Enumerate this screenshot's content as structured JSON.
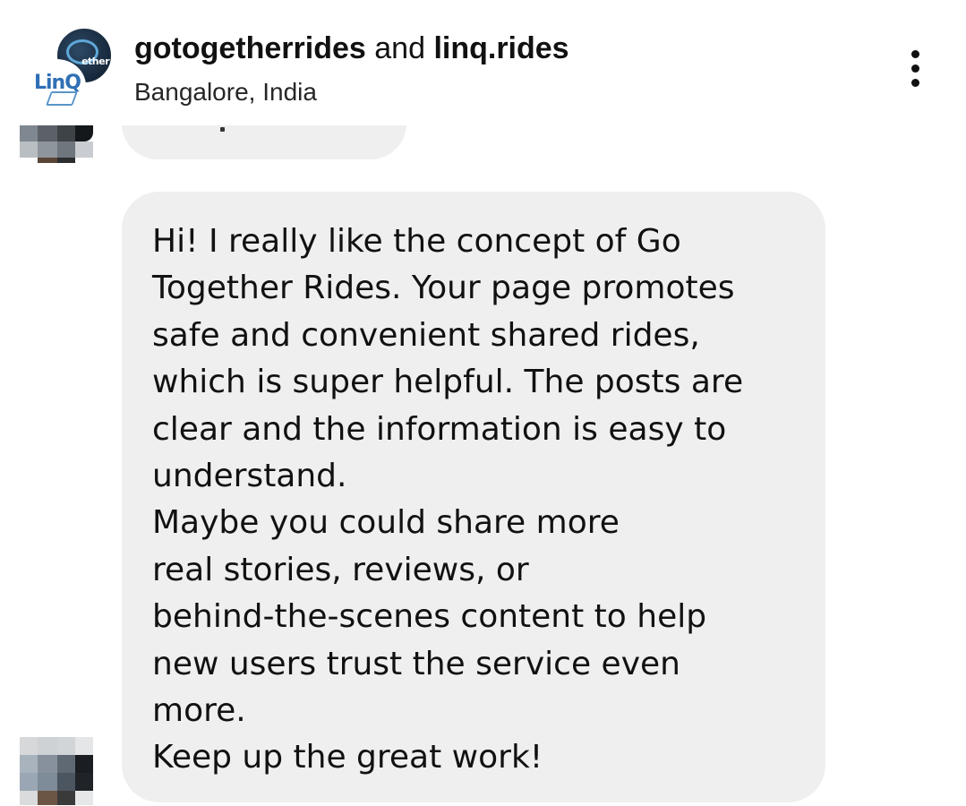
{
  "header": {
    "title_user_1": "gotogetherrides",
    "title_joiner": "and",
    "title_user_2": "linq.rides",
    "location": "Bangalore, India",
    "avatar_back_tag": "ether",
    "avatar_front_logo": "LinQ",
    "more_icon": "more-vertical-icon"
  },
  "thread": {
    "message_text": "Hi! I really like the concept of Go\nTogether Rides. Your page promotes\nsafe and convenient shared rides,\nwhich is super helpful. The posts are\nclear and the information is easy to\nunderstand.\nMaybe you could share more\nreal stories, reviews, or\nbehind-the-scenes content to help\nnew users trust the service even\nmore.\nKeep up the great work!"
  },
  "colors": {
    "bubble_background": "#efefef",
    "page_background": "#ffffff",
    "text_primary": "#111111",
    "text_secondary": "#262626",
    "logo_blue": "#2f6fb5"
  }
}
